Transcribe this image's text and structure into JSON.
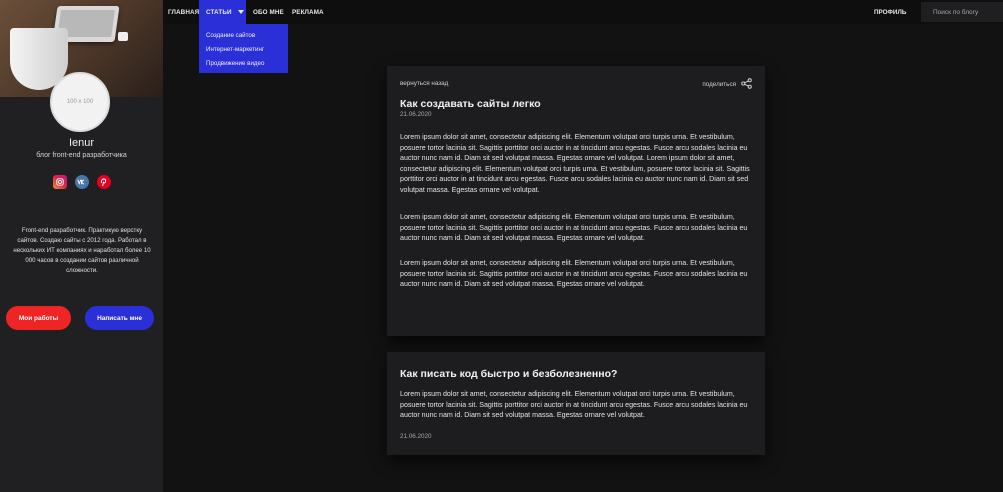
{
  "nav": {
    "items": [
      "ГЛАВНАЯ",
      "СТАТЬИ",
      "ОБО МНЕ",
      "РЕКЛАМА"
    ],
    "profile": "ПРОФИЛЬ",
    "search_placeholder": "Поиск по блогу",
    "dropdown": [
      "Создание сайтов",
      "Интернет-маркетинг",
      "Продвижение видео"
    ]
  },
  "sidebar": {
    "avatar_text": "100 x 100",
    "username": "Ienur",
    "tagline": "блог front-end разработчика",
    "bio": "Front-end разработчик. Практикую верстку сайтов. Создаю сайты с 2012 года. Работал в нескольких ИТ компаниях и наработал более 10 000 часов в создании сайтов различной сложности.",
    "btn_works": "Мои работы",
    "btn_write": "Написать мне",
    "socials": [
      "instagram-icon",
      "vk-icon",
      "pinterest-icon"
    ]
  },
  "article": {
    "back": "вернуться назад",
    "share": "поделиться",
    "title": "Как создавать сайты легко",
    "date": "21.06.2020",
    "paragraphs": [
      "Lorem ipsum dolor sit amet, consectetur adipiscing elit. Elementum volutpat orci turpis urna. Et vestibulum, posuere tortor lacinia sit. Sagittis porttitor orci auctor in at tincidunt arcu egestas. Fusce arcu sodales lacinia eu auctor nunc nam id. Diam sit sed volutpat massa. Egestas ornare vel volutpat. Lorem ipsum dolor sit amet, consectetur adipiscing elit. Elementum volutpat orci turpis urna. Et vestibulum, posuere tortor lacinia sit. Sagittis porttitor orci auctor in at tincidunt arcu egestas. Fusce arcu sodales lacinia eu auctor nunc nam id. Diam sit sed volutpat massa. Egestas ornare vel volutpat.",
      "Lorem ipsum dolor sit amet, consectetur adipiscing elit. Elementum volutpat orci turpis urna. Et vestibulum, posuere tortor lacinia sit. Sagittis porttitor orci auctor in at tincidunt arcu egestas. Fusce arcu sodales lacinia eu auctor nunc nam id. Diam sit sed volutpat massa. Egestas ornare vel volutpat.",
      "Lorem ipsum dolor sit amet, consectetur adipiscing elit. Elementum volutpat orci turpis urna. Et vestibulum, posuere tortor lacinia sit. Sagittis porttitor orci auctor in at tincidunt arcu egestas. Fusce arcu sodales lacinia eu auctor nunc nam id. Diam sit sed volutpat massa. Egestas ornare vel volutpat."
    ]
  },
  "article2": {
    "title": "Как писать код быстро и безболезненно?",
    "text": "Lorem ipsum dolor sit amet, consectetur adipiscing elit. Elementum volutpat orci turpis urna. Et vestibulum, posuere tortor lacinia sit. Sagittis porttitor orci auctor in at tincidunt arcu egestas. Fusce arcu sodales lacinia eu auctor nunc nam id. Diam sit sed volutpat massa. Egestas ornare vel volutpat.",
    "date": "21.06.2020"
  },
  "colors": {
    "accent_blue": "#2a2fd8",
    "accent_red": "#ef2525",
    "background": "#121212",
    "card": "#1d1d1f"
  }
}
